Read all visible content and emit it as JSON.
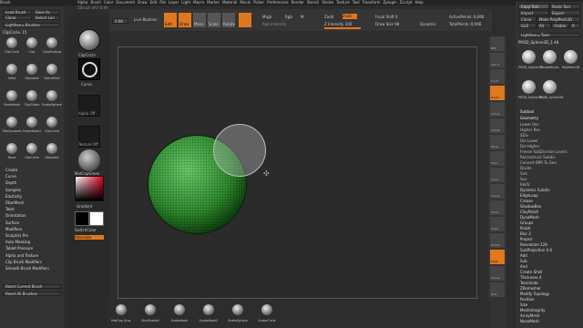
{
  "app": {
    "title": "Brush",
    "version": "ZBrush 4R7 0.96"
  },
  "menus": [
    "Alpha",
    "Brush",
    "Color",
    "Document",
    "Draw",
    "Edit",
    "File",
    "Layer",
    "Light",
    "Macro",
    "Marker",
    "Material",
    "Movie",
    "Picker",
    "Preferences",
    "Render",
    "Stencil",
    "Stroke",
    "Texture",
    "Tool",
    "Transform",
    "Zplugin",
    "Zscript",
    "Help"
  ],
  "left": {
    "top_buttons": [
      "Load Brush",
      "Save As",
      "Clone",
      "Select Lon"
    ],
    "lightbox": "Lightbox ▸ Brushes",
    "brush_label": "ClipCircle.  15",
    "brushes": [
      "ClipCircle",
      "Clay",
      "ClayBuildup",
      "Inflat",
      "Standard",
      "SelectRect",
      "SnakeHook",
      "ClayTubes",
      "SnakeSphere",
      "TrimDynamic",
      "SnakeHook2",
      "ClipCurve",
      "Move",
      "ClipCircle",
      "Standard"
    ],
    "section_items": [
      "Create",
      "Curve",
      "Depth",
      "Samples",
      "Elasticity",
      "FiberMesh",
      "Twist",
      "Orientation",
      "Surface",
      "Modifiers",
      "Sculptris Pro",
      "Auto Masking",
      "Tablet Pressure",
      "Alpha and Texture",
      "Clip Brush Modifiers",
      "Smooth Brush Modifiers"
    ],
    "bottom_buttons": [
      "Reset Current Brush",
      "Reset All Brushes"
    ]
  },
  "shelf": {
    "labels": [
      "ClipCircle",
      "Curve",
      "Alpha Off",
      "Texture Off",
      "MatCapGreen",
      "Gradient",
      "SwitchColor",
      "Alternate"
    ]
  },
  "toolbar": {
    "buttons": [
      "Live Boolean",
      "Edit",
      "Draw",
      "Move",
      "Scale",
      "Rotate"
    ],
    "fields": {
      "mrgb": "Mrgb",
      "rgb": "Rgb",
      "m": "M",
      "zadd": "Zadd",
      "zsub": "Zsub",
      "zcut": "Zcut"
    },
    "rgb_intensity": "Rgb Intensity",
    "z_intensity": "Z Intensity 100",
    "focal_shift": "Focal Shift 0",
    "draw_size": "Draw Size 98",
    "dynamic": "Dynamic",
    "active_points": "ActivePoints: 8,066",
    "total_points": "TotalPoints: 8,066",
    "zoom_value": "0.66"
  },
  "right_strip": [
    "BPR",
    "SPix 3",
    "Scroll",
    "Zoom",
    "Actual",
    "AAHalf",
    "Persp",
    "Floor",
    "Local",
    "Frame",
    "Move",
    "Scale",
    "Rotate",
    "PolyF",
    "Transp",
    "Solo"
  ],
  "tool": {
    "top_buttons": [
      "Copy Tool",
      "Paste Tool",
      "Import",
      "Export",
      "Clone",
      "Make PolyMesh3D",
      "GoZ",
      "All",
      "Visible",
      "R"
    ],
    "lightbox": "Lightbox ▸ Tools",
    "current": "PM3D_Sphere3D_1  48",
    "tools": [
      "PM3D_Sphere3D",
      "SimpleBrush",
      "PolyMesh3D",
      "PM3D_Sphere3D_1",
      "PM3D_Sphere3D"
    ],
    "subtools": [
      "Subtool",
      "Geometry"
    ],
    "geometry": [
      "Lower Res",
      "Higher Res",
      "SDiv",
      "Del Lower",
      "Del Higher",
      "Freeze SubDivision Levels",
      "Reconstruct Subdiv",
      "Convert BPR To Geo",
      "Divide",
      "Smt",
      "Suv",
      "ReUV"
    ],
    "sections": [
      "Dynamic Subdiv",
      "EdgeLoop",
      "Crease",
      "ShadowBox",
      "ClayPolish",
      "DynaMesh",
      "Groups",
      "Polish",
      "Blur 2",
      "Project",
      "Resolution 128",
      "SubProjection 0.6",
      "Add",
      "Sub",
      "And",
      "Create Shell",
      "Thickness 4",
      "Tessimate",
      "ZRemesher",
      "Modify Topology",
      "Position",
      "Size",
      "MeshIntegrity",
      "ArrayMesh",
      "NanoMesh"
    ]
  },
  "bottom": {
    "brushes": [
      "MatCap Gray",
      "SkinShade4",
      "SnakeHook",
      "SnakeHook2",
      "SnakeSphere",
      "SnakeCircle"
    ]
  },
  "colors": {
    "accent": "#e0781d",
    "bg": "#2d2d2d",
    "panel": "#3a3a3a",
    "canvas": "#2b2b2b",
    "sphere": "#3c9a3c"
  }
}
